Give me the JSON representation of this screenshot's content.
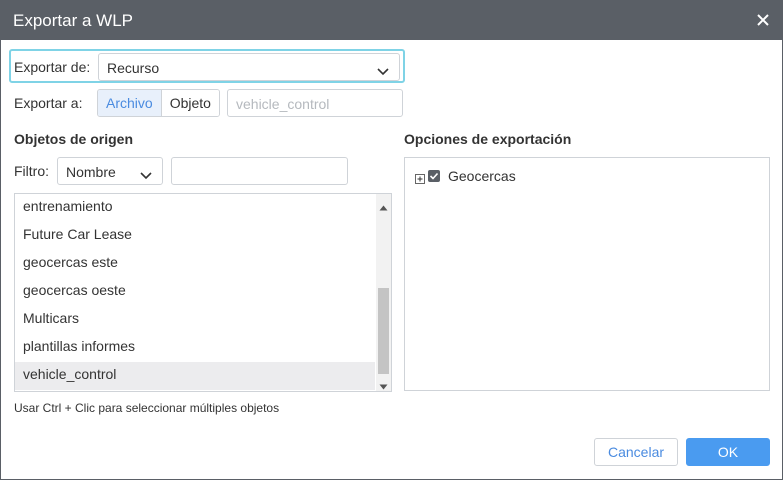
{
  "dialog": {
    "title": "Exportar a WLP"
  },
  "export_from": {
    "label": "Exportar de:",
    "selected": "Recurso"
  },
  "export_to": {
    "label": "Exportar a:",
    "options": [
      "Archivo",
      "Objeto"
    ],
    "active": "Archivo",
    "object_placeholder": "vehicle_control"
  },
  "source": {
    "heading": "Objetos de origen",
    "filter_label": "Filtro:",
    "filter_selected": "Nombre",
    "filter_value": "",
    "items": [
      "entrenamiento",
      "Future Car Lease",
      "geocercas este",
      "geocercas oeste",
      "Multicars",
      "plantillas informes",
      "vehicle_control"
    ],
    "selected_item": "vehicle_control"
  },
  "options": {
    "heading": "Opciones de exportación",
    "tree": [
      {
        "label": "Geocercas",
        "checked": true,
        "expanded": false
      }
    ]
  },
  "hint": "Usar Ctrl + Clic para seleccionar múltiples objetos",
  "buttons": {
    "cancel": "Cancelar",
    "ok": "OK"
  },
  "colors": {
    "titlebar": "#5a5f66",
    "accent": "#4a9bf0",
    "focus_border": "#7fd3e6"
  }
}
